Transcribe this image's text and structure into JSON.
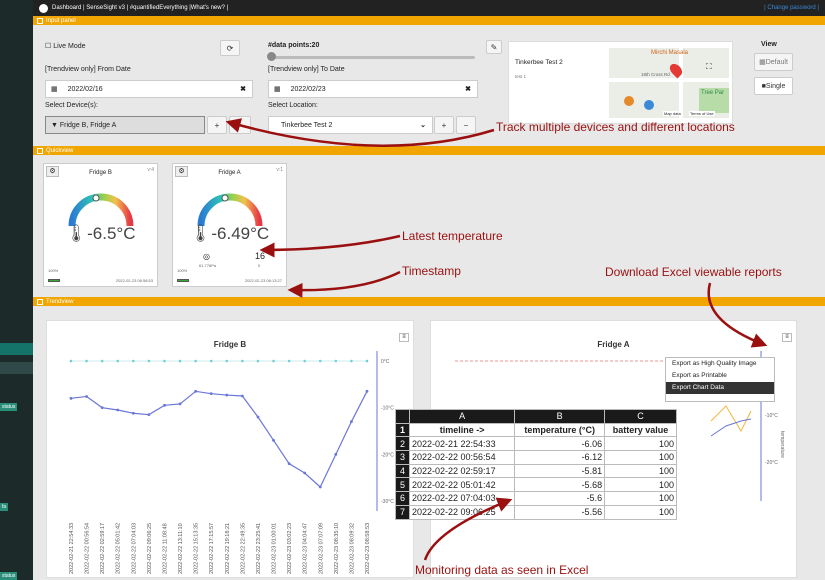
{
  "topbar": {
    "title": "Dashboard | SenseSight v3 | #quantifiedEverything |What's new? |",
    "links": "| Change password |"
  },
  "sections": {
    "input": "Input panel",
    "quick": "Quickview",
    "trend": "Trendview"
  },
  "input_panel": {
    "live_mode": "Live Mode",
    "from_label": "[Trendview only] From Date",
    "from_value": "2022/02/16",
    "to_label": "[Trendview only] To Date",
    "to_value": "2022/02/23",
    "data_points": "#data points:20",
    "devices_label": "Select Device(s):",
    "devices_value": "▼ Fridge B, Fridge A",
    "location_label": "Select Location:",
    "location_value": "Tinkerbee Test 2",
    "location_card_name": "Tinkerbee Test 2",
    "location_card_sub": "test 1",
    "view_label": "View",
    "view_default": "Default",
    "view_single": "Single",
    "map_labels": [
      "Mirchi Masala",
      "18th Cross Rd",
      "Tree Par",
      "Map data",
      "Terms of Use"
    ]
  },
  "quickview": [
    {
      "name": "Fridge B",
      "version": "v:4",
      "temp": "-6.5°C",
      "timestamp": "2022-02-23 06:58:53",
      "battery": "100%"
    },
    {
      "name": "Fridge A",
      "version": "v:1",
      "temp": "-6.49°C",
      "timestamp": "2022-02-23 06:13:27",
      "battery": "100%",
      "extra_left": "61.776Pa",
      "extra_right": "0",
      "extra_right_top": "16"
    }
  ],
  "charts": [
    {
      "title": "Fridge B",
      "axis_label": "temperature",
      "ticks": [
        "0°C",
        "-10°C",
        "-20°C",
        "-30°C"
      ]
    },
    {
      "title": "Fridge A",
      "axis_label": "temperature",
      "ticks": [
        "0°C",
        "-10°C",
        "-20°C"
      ]
    }
  ],
  "chart_data": {
    "type": "line",
    "title": "Fridge B",
    "x": [
      "2022-02-21 22:54:33",
      "2022-02-22 00:56:54",
      "2022-02-22 02:59:17",
      "2022-02-22 05:01:42",
      "2022-02-22 07:04:03",
      "2022-02-22 09:06:25",
      "2022-02-22 11:08:48",
      "2022-02-22 13:11:10",
      "2022-02-22 15:13:35",
      "2022-02-22 17:15:57",
      "2022-02-22 19:18:21",
      "2022-02-22 22:49:35",
      "2022-02-22 23:25:41",
      "2022-02-23 01:00:01",
      "2022-02-23 03:02:23",
      "2022-02-23 04:04:47",
      "2022-02-23 07:07:09",
      "2022-02-23 08:35:10",
      "2022-02-23 08:09:32",
      "2022-02-23 08:58:53"
    ],
    "series": [
      {
        "values": [
          -8,
          -7.6,
          -10,
          -10.5,
          -11.2,
          -11.5,
          -9.5,
          -9.2,
          -6.5,
          -7,
          -7.3,
          -7.5,
          -12,
          -17,
          -22,
          -24,
          -27,
          -20,
          -13,
          -6.5
        ]
      }
    ],
    "ylim": [
      -30,
      0
    ]
  },
  "menu": {
    "items": [
      "Export as High Quality Image",
      "Export as Printable",
      "Export Chart Data"
    ]
  },
  "excel": {
    "cols": [
      "A",
      "B",
      "C"
    ],
    "header": [
      "timeline ->",
      "temperature (°C)",
      "battery value"
    ],
    "rows": [
      [
        "2022-02-21 22:54:33",
        "-6.06",
        "100"
      ],
      [
        "2022-02-22 00:56:54",
        "-6.12",
        "100"
      ],
      [
        "2022-02-22 02:59:17",
        "-5.81",
        "100"
      ],
      [
        "2022-02-22 05:01:42",
        "-5.68",
        "100"
      ],
      [
        "2022-02-22 07:04:03",
        "-5.6",
        "100"
      ],
      [
        "2022-02-22 09:06:25",
        "-5.56",
        "100"
      ]
    ]
  },
  "annotations": {
    "track": "Track multiple devices and different locations",
    "latest": "Latest temperature",
    "timestamp": "Timestamp",
    "download": "Download Excel viewable reports",
    "monitoring": "Monitoring data as seen in Excel"
  },
  "leftstrip": {
    "status1": "status",
    "status2": "status",
    "fa": "fa"
  }
}
